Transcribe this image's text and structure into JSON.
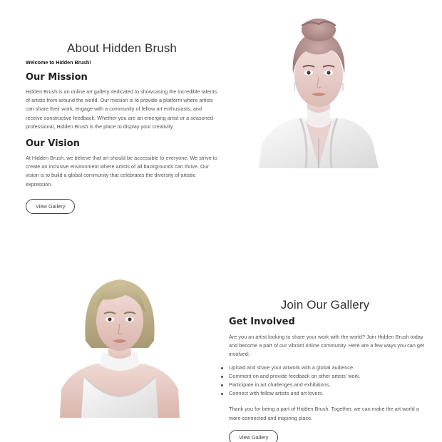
{
  "about": {
    "title": "About Hidden Brush",
    "welcome": "Welcome to Hidden Brush!",
    "mission_heading": "Our Mission",
    "mission_text": "Hidden Brush is an online art gallery dedicated to showcasing the incredible talents of artists from around the world. Our mission is to provide a platform where artists can share their work, engage with a community of fellow art enthusiasts, and receive constructive feedback. Whether you are an emerging artist or a seasoned professional, Hidden Brush is the place to display your creativity.",
    "vision_heading": "Our Vision",
    "vision_text": "At Hidden Brush, we believe that art should be accessible to everyone. We strive to create an inclusive environment where artists of all backgrounds can thrive. Our vision is to build a global community that celebrates the diversity of artistic expression.",
    "button_label": "View Gallery"
  },
  "join": {
    "title": "Join Our Gallery",
    "heading": "Get Involved",
    "intro": "Are you an artist looking to share your work with the world? Join Hidden Brush today and become a part of our vibrant online community. Here are a few ways you can get involved:",
    "bullets": [
      "Upload and share your artwork with a global audience.",
      "Comment on and provide feedback on other artists' work.",
      "Participate in art challenges and exhibitions.",
      "Connect with fellow artists and art lovers."
    ],
    "closing": "Thank you for being a part of Hidden Brush. Together, we can make the art world a more connected and inspiring place.",
    "button_label": "View Gallery"
  },
  "colors": {
    "text": "#333333",
    "paragraph": "#555555",
    "button_border": "#444444"
  }
}
